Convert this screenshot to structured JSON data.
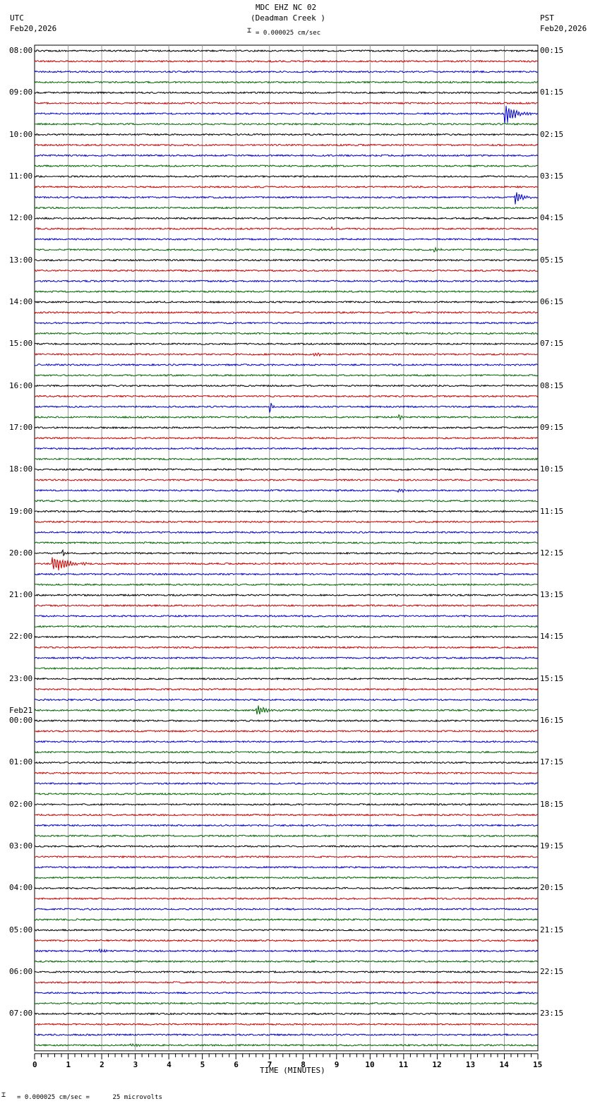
{
  "header": {
    "title": "MDC EHZ NC 02",
    "subtitle": "(Deadman Creek )",
    "scale_label": "= 0.000025 cm/sec",
    "left_tz": "UTC",
    "left_date": "Feb20,2026",
    "right_tz": "PST",
    "right_date": "Feb20,2026"
  },
  "footer": {
    "scale_text": "= 0.000025 cm/sec =      25 microvolts"
  },
  "chart_data": {
    "type": "line",
    "title": "MDC EHZ NC 02 (Deadman Creek )",
    "xlabel": "TIME (MINUTES)",
    "xlim": [
      0,
      15
    ],
    "x_ticks": [
      "0",
      "1",
      "2",
      "3",
      "4",
      "5",
      "6",
      "7",
      "8",
      "9",
      "10",
      "11",
      "12",
      "13",
      "14",
      "15"
    ],
    "traces_per_hour": 4,
    "trace_colors": [
      "#000000",
      "#cc0000",
      "#0000cc",
      "#006600"
    ],
    "left_labels": [
      "08:00",
      "09:00",
      "10:00",
      "11:00",
      "12:00",
      "13:00",
      "14:00",
      "15:00",
      "16:00",
      "17:00",
      "18:00",
      "19:00",
      "20:00",
      "21:00",
      "22:00",
      "23:00",
      "00:00",
      "01:00",
      "02:00",
      "03:00",
      "04:00",
      "05:00",
      "06:00",
      "07:00"
    ],
    "date_change_label": "Feb21",
    "date_change_hour_index": 16,
    "right_labels": [
      "00:15",
      "01:15",
      "02:15",
      "03:15",
      "04:15",
      "05:15",
      "06:15",
      "07:15",
      "08:15",
      "09:15",
      "10:15",
      "11:15",
      "12:15",
      "13:15",
      "14:15",
      "15:15",
      "16:15",
      "17:15",
      "18:15",
      "19:15",
      "20:15",
      "21:15",
      "22:15",
      "23:15"
    ],
    "events": [
      {
        "trace": 6,
        "minute": 14.0,
        "amplitude": 20,
        "duration": 0.8
      },
      {
        "trace": 14,
        "minute": 14.3,
        "amplitude": 12,
        "duration": 0.6
      },
      {
        "trace": 19,
        "minute": 11.9,
        "amplitude": 6,
        "duration": 0.3
      },
      {
        "trace": 17,
        "minute": 8.85,
        "amplitude": 4,
        "duration": 0.1
      },
      {
        "trace": 29,
        "minute": 8.3,
        "amplitude": 3,
        "duration": 0.7
      },
      {
        "trace": 34,
        "minute": 7.0,
        "amplitude": 14,
        "duration": 0.2
      },
      {
        "trace": 35,
        "minute": 10.85,
        "amplitude": 8,
        "duration": 0.2
      },
      {
        "trace": 39,
        "minute": 1.55,
        "amplitude": 5,
        "duration": 0.1
      },
      {
        "trace": 42,
        "minute": 10.8,
        "amplitude": 4,
        "duration": 0.6
      },
      {
        "trace": 49,
        "minute": 0.5,
        "amplitude": 16,
        "duration": 1.2
      },
      {
        "trace": 48,
        "minute": 0.8,
        "amplitude": 10,
        "duration": 0.3
      },
      {
        "trace": 63,
        "minute": 6.6,
        "amplitude": 9,
        "duration": 0.8
      },
      {
        "trace": 86,
        "minute": 1.9,
        "amplitude": 4,
        "duration": 0.5
      },
      {
        "trace": 95,
        "minute": 2.85,
        "amplitude": 4,
        "duration": 0.6
      }
    ]
  }
}
